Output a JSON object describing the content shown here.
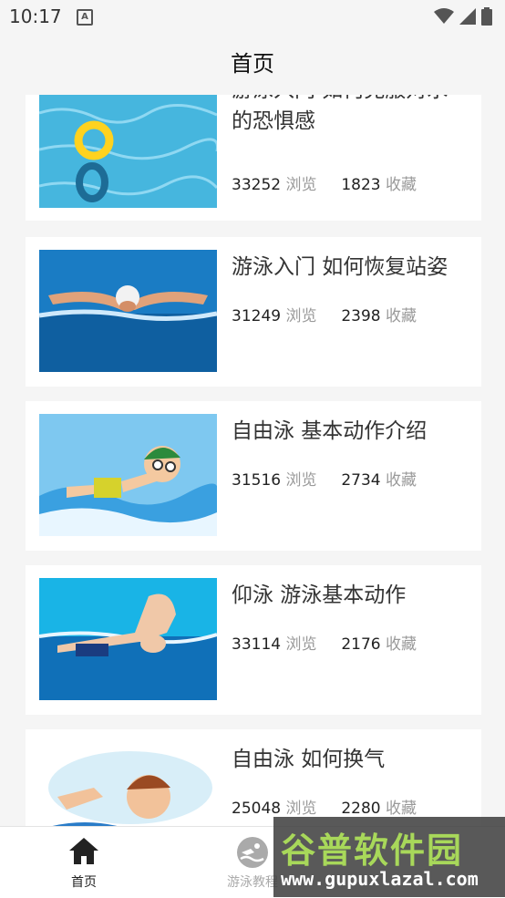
{
  "status_bar": {
    "time": "10:17",
    "a_icon": "A"
  },
  "header": {
    "title": "首页"
  },
  "articles": [
    {
      "title": "游泳入门 如何克服对水的恐惧感",
      "views": "33252",
      "views_unit": "浏览",
      "favorites": "1823",
      "favorites_unit": "收藏",
      "thumb_icon": "swim-ring-image"
    },
    {
      "title": "游泳入门 如何恢复站姿",
      "views": "31249",
      "views_unit": "浏览",
      "favorites": "2398",
      "favorites_unit": "收藏",
      "thumb_icon": "butterfly-swimmer-image"
    },
    {
      "title": "自由泳 基本动作介绍",
      "views": "31516",
      "views_unit": "浏览",
      "favorites": "2734",
      "favorites_unit": "收藏",
      "thumb_icon": "cartoon-swimmer-image"
    },
    {
      "title": "仰泳 游泳基本动作",
      "views": "33114",
      "views_unit": "浏览",
      "favorites": "2176",
      "favorites_unit": "收藏",
      "thumb_icon": "freestyle-swimmer-image"
    },
    {
      "title": "自由泳 如何换气",
      "views": "25048",
      "views_unit": "浏览",
      "favorites": "2280",
      "favorites_unit": "收藏",
      "thumb_icon": "cartoon-boy-swimming-image"
    }
  ],
  "bottom_nav": [
    {
      "label": "首页",
      "icon": "home-icon",
      "active": true
    },
    {
      "label": "游泳教程",
      "icon": "swim-icon",
      "active": false
    }
  ],
  "watermark": {
    "title": "谷普软件园",
    "url": "www.gupuxlazal.com"
  },
  "colors": {
    "accent": "#222222",
    "inactive": "#aaaaaa",
    "stat_unit": "#9a9a9a",
    "watermark_green": "#a8d85a"
  }
}
